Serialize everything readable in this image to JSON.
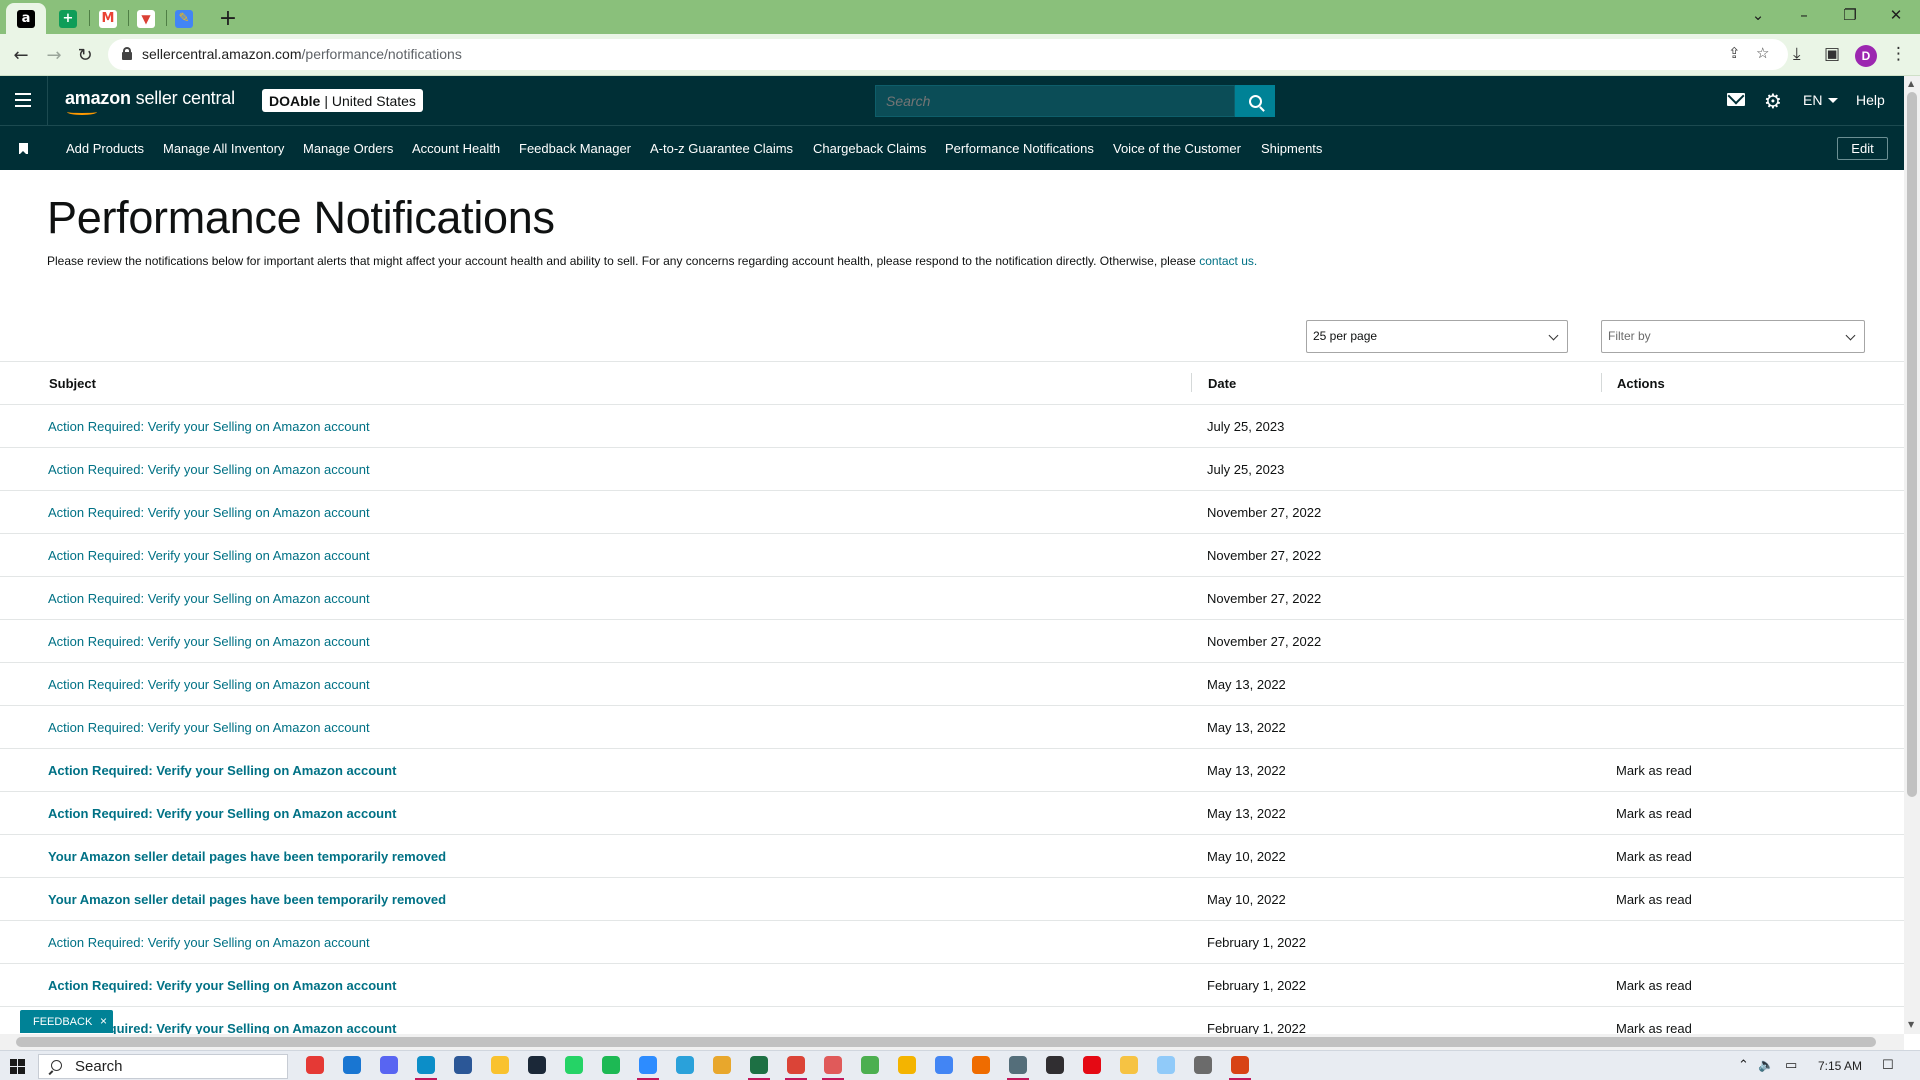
{
  "browser": {
    "url_host": "sellercentral.amazon.com",
    "url_path": "/performance/notifications",
    "profile_initial": "D",
    "tabs": [
      {
        "icon": "amazon-favicon",
        "glyph": "a",
        "color": "#000000"
      },
      {
        "icon": "sheets-favicon",
        "glyph": "+",
        "color": "#0f9d58"
      },
      {
        "icon": "gmail-favicon",
        "glyph": "M",
        "color": "#ea4335"
      },
      {
        "icon": "todoist-favicon",
        "glyph": "▼",
        "color": "#db4035"
      },
      {
        "icon": "pencil-favicon",
        "glyph": "✎",
        "color": "#f4b400"
      }
    ]
  },
  "header": {
    "logo_brand": "amazon",
    "logo_product": "seller central",
    "account_name": "DOAble",
    "account_region": "United States",
    "search_placeholder": "Search",
    "language": "EN",
    "help": "Help"
  },
  "nav": {
    "items": [
      "Add Products",
      "Manage All Inventory",
      "Manage Orders",
      "Account Health",
      "Feedback Manager",
      "A-to-z Guarantee Claims",
      "Chargeback Claims",
      "Performance Notifications",
      "Voice of the Customer",
      "Shipments"
    ],
    "edit": "Edit"
  },
  "page": {
    "title": "Performance Notifications",
    "intro": "Please review the notifications below for important alerts that might affect your account health and ability to sell. For any concerns regarding account health, please respond to the notification directly. Otherwise, please",
    "contact_link": "contact us.",
    "per_page": "25 per page",
    "filter_placeholder": "Filter by"
  },
  "table": {
    "headers": {
      "subject": "Subject",
      "date": "Date",
      "actions": "Actions"
    },
    "rows": [
      {
        "subject": "Action Required: Verify your Selling on Amazon account",
        "date": "July 25, 2023",
        "action": "",
        "unread": false
      },
      {
        "subject": "Action Required: Verify your Selling on Amazon account",
        "date": "July 25, 2023",
        "action": "",
        "unread": false
      },
      {
        "subject": "Action Required: Verify your Selling on Amazon account",
        "date": "November 27, 2022",
        "action": "",
        "unread": false
      },
      {
        "subject": "Action Required: Verify your Selling on Amazon account",
        "date": "November 27, 2022",
        "action": "",
        "unread": false
      },
      {
        "subject": "Action Required: Verify your Selling on Amazon account",
        "date": "November 27, 2022",
        "action": "",
        "unread": false
      },
      {
        "subject": "Action Required: Verify your Selling on Amazon account",
        "date": "November 27, 2022",
        "action": "",
        "unread": false
      },
      {
        "subject": "Action Required: Verify your Selling on Amazon account",
        "date": "May 13, 2022",
        "action": "",
        "unread": false
      },
      {
        "subject": "Action Required: Verify your Selling on Amazon account",
        "date": "May 13, 2022",
        "action": "",
        "unread": false
      },
      {
        "subject": "Action Required: Verify your Selling on Amazon account",
        "date": "May 13, 2022",
        "action": "Mark as read",
        "unread": true
      },
      {
        "subject": "Action Required: Verify your Selling on Amazon account",
        "date": "May 13, 2022",
        "action": "Mark as read",
        "unread": true
      },
      {
        "subject": "Your Amazon seller detail pages have been temporarily removed",
        "date": "May 10, 2022",
        "action": "Mark as read",
        "unread": true
      },
      {
        "subject": "Your Amazon seller detail pages have been temporarily removed",
        "date": "May 10, 2022",
        "action": "Mark as read",
        "unread": true
      },
      {
        "subject": "Action Required: Verify your Selling on Amazon account",
        "date": "February 1, 2022",
        "action": "",
        "unread": false
      },
      {
        "subject": "Action Required: Verify your Selling on Amazon account",
        "date": "February 1, 2022",
        "action": "Mark as read",
        "unread": true
      },
      {
        "subject": "Action Required: Verify your Selling on Amazon account",
        "date": "February 1, 2022",
        "action": "Mark as read",
        "unread": true
      }
    ]
  },
  "feedback": {
    "label": "FEEDBACK",
    "close": "×"
  },
  "taskbar": {
    "search": "Search",
    "time": "7:15 AM",
    "apps": [
      {
        "icon": "record-icon",
        "color": "#e53935"
      },
      {
        "icon": "mail-app-icon",
        "color": "#1976d2"
      },
      {
        "icon": "discord-icon",
        "color": "#5865f2"
      },
      {
        "icon": "edge-icon",
        "color": "#0c8ec8"
      },
      {
        "icon": "store-icon",
        "color": "#2b5797"
      },
      {
        "icon": "file-explorer-icon",
        "color": "#f9c22e"
      },
      {
        "icon": "steam-icon",
        "color": "#1b2838"
      },
      {
        "icon": "whatsapp-icon",
        "color": "#25d366"
      },
      {
        "icon": "spotify-icon",
        "color": "#1db954"
      },
      {
        "icon": "zoom-icon",
        "color": "#2d8cff"
      },
      {
        "icon": "telegram-icon",
        "color": "#2aa1da"
      },
      {
        "icon": "chrome-icon",
        "color": "#e8a72c"
      },
      {
        "icon": "excel-icon",
        "color": "#1d7044"
      },
      {
        "icon": "chrome-profile-1-icon",
        "color": "#db4437"
      },
      {
        "icon": "chrome-profile-2-icon",
        "color": "#e05a5a"
      },
      {
        "icon": "chrome-profile-3-icon",
        "color": "#4caf50"
      },
      {
        "icon": "chrome-profile-4-icon",
        "color": "#f4b400"
      },
      {
        "icon": "chrome-profile-5-icon",
        "color": "#4285f4"
      },
      {
        "icon": "paint-icon",
        "color": "#ef6c00"
      },
      {
        "icon": "calculator-icon",
        "color": "#546e7a"
      },
      {
        "icon": "obs-icon",
        "color": "#302e31"
      },
      {
        "icon": "netflix-icon",
        "color": "#e50914"
      },
      {
        "icon": "sticky-notes-icon",
        "color": "#f6c343"
      },
      {
        "icon": "notepad-icon",
        "color": "#90caf9"
      },
      {
        "icon": "settings-icon",
        "color": "#6b6b6b"
      },
      {
        "icon": "snipping-tool-icon",
        "color": "#d84315"
      }
    ]
  }
}
